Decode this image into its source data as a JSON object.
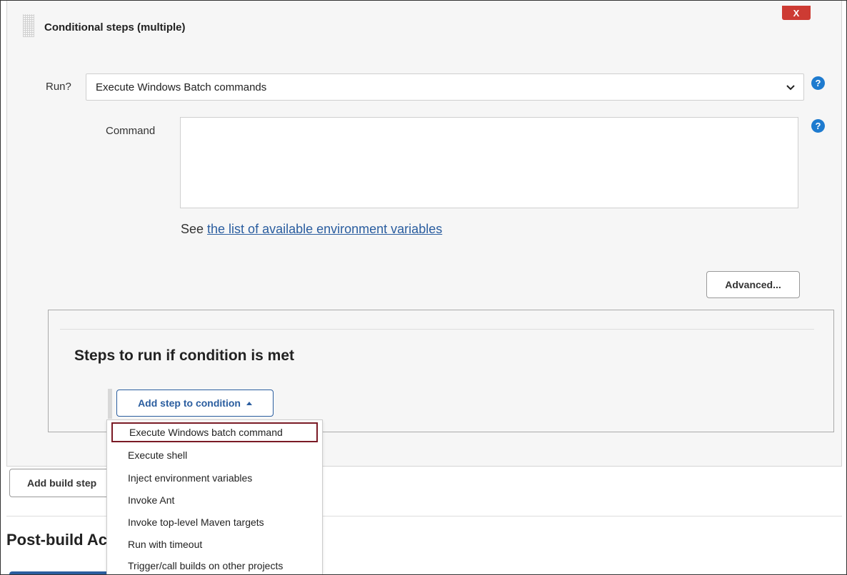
{
  "panel": {
    "title": "Conditional steps (multiple)",
    "close_label": "X",
    "run_label": "Run?",
    "run_selected": "Execute Windows Batch commands",
    "command_label": "Command",
    "command_value": "",
    "env_prefix": "See ",
    "env_link": "the list of available environment variables",
    "advanced_label": "Advanced..."
  },
  "steps": {
    "title": "Steps to run if condition is met",
    "add_label": "Add step to condition"
  },
  "dropdown": {
    "items": [
      "Execute Windows batch command",
      "Execute shell",
      "Inject environment variables",
      "Invoke Ant",
      "Invoke top-level Maven targets",
      "Run with timeout",
      "Trigger/call builds on other projects"
    ]
  },
  "footer": {
    "add_build_label": "Add build step",
    "post_build_title": "Post-build Actions"
  },
  "help_label": "?",
  "colors": {
    "close": "#cd3b33",
    "help": "#1e7bcf",
    "link": "#2a5d9f",
    "selected_outline": "#7a1a25",
    "panel_bg": "#f6f6f6"
  }
}
